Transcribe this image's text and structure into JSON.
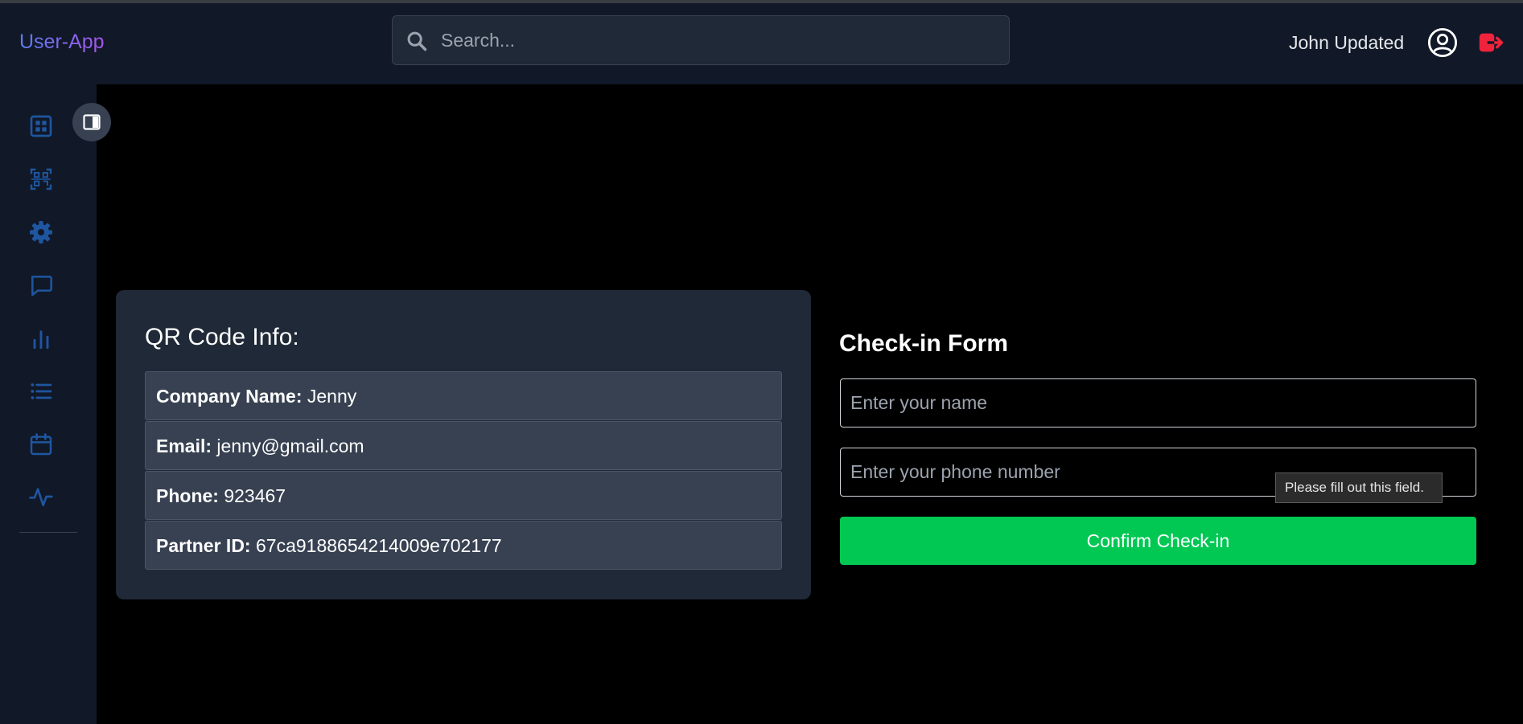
{
  "header": {
    "brand": "User-App",
    "search_placeholder": "Search...",
    "username": "John Updated"
  },
  "sidebar": {
    "items": [
      {
        "icon": "dashboard-icon"
      },
      {
        "icon": "qr-scan-icon"
      },
      {
        "icon": "gear-icon"
      },
      {
        "icon": "chat-icon"
      },
      {
        "icon": "bar-chart-icon"
      },
      {
        "icon": "list-icon"
      },
      {
        "icon": "calendar-icon"
      },
      {
        "icon": "activity-icon"
      }
    ],
    "toggle_icon": "sidebar-toggle-icon"
  },
  "qr_info": {
    "title": "QR Code Info:",
    "rows": [
      {
        "label": "Company Name:",
        "value": "Jenny"
      },
      {
        "label": "Email:",
        "value": "jenny@gmail.com"
      },
      {
        "label": "Phone:",
        "value": "923467"
      },
      {
        "label": "Partner ID:",
        "value": "67ca9188654214009e702177"
      }
    ]
  },
  "checkin_form": {
    "title": "Check-in Form",
    "name_placeholder": "Enter your name",
    "phone_placeholder": "Enter your phone number",
    "submit_label": "Confirm Check-in",
    "validation_tooltip": "Please fill out this field."
  },
  "colors": {
    "header_bg": "#111827",
    "card_bg": "#1f2937",
    "row_bg": "#374151",
    "accent_blue": "#1e56a0",
    "button_green": "#00c853",
    "logout_red": "#ef233c"
  }
}
